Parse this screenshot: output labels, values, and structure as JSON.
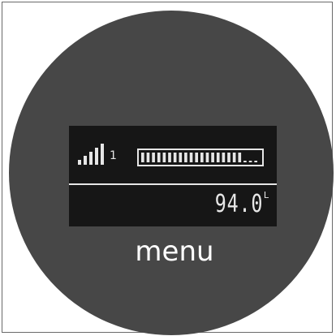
{
  "device": {
    "background_color": "#474747",
    "screen_color": "#161616",
    "text_color": "#e6e6e6"
  },
  "status": {
    "signal_icon": "signal-bars-icon",
    "signal_level_fraction": 1.0,
    "channel": "1",
    "level_segments_total": 22,
    "level_segments_filled": 19
  },
  "reading": {
    "value": "94.0",
    "unit": "L"
  },
  "menu": {
    "label": "menu"
  }
}
